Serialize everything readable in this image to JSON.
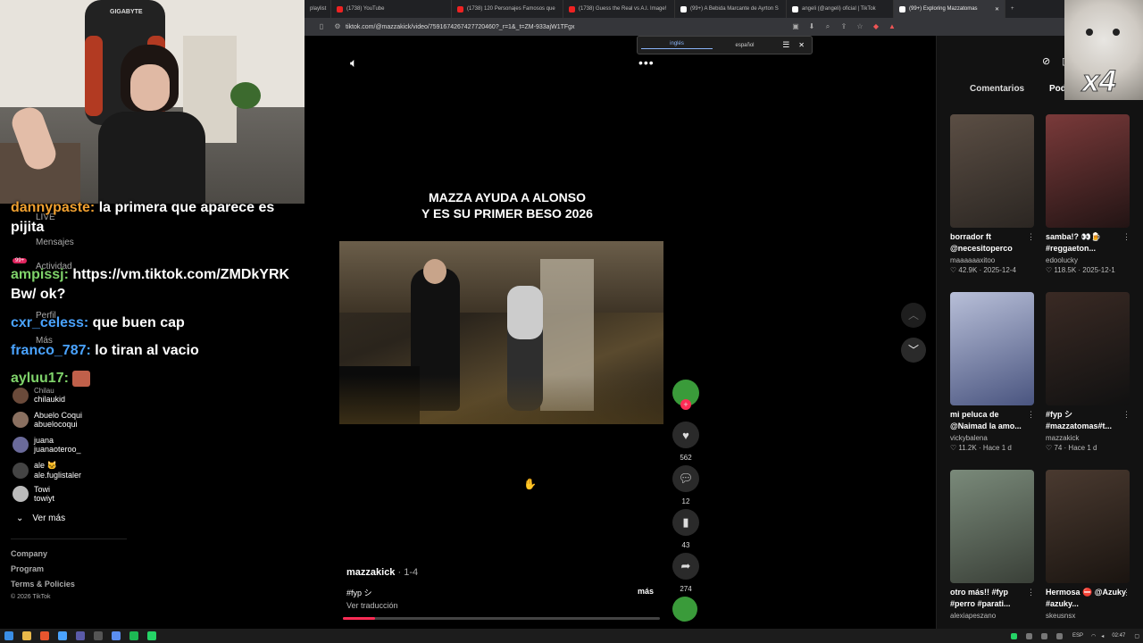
{
  "tabs": [
    {
      "label": "playlist",
      "active": false,
      "color": "#c33"
    },
    {
      "label": "(1738) YouTube",
      "active": false,
      "color": "#e22"
    },
    {
      "label": "(1738) 120 Personajes Famosos que",
      "active": false,
      "color": "#e22"
    },
    {
      "label": "(1738) Guess the Real vs A.I. Image!",
      "active": false,
      "color": "#e22"
    },
    {
      "label": "(99+) A Bebida Marcante de Ayrton S",
      "active": false,
      "color": "#ddd"
    },
    {
      "label": "angeli (@angeli) oficial | TikTok",
      "active": false,
      "color": "#ddd"
    },
    {
      "label": "(99+) Exploring Mazzatomas",
      "active": true,
      "color": "#ddd"
    }
  ],
  "url": "tiktok.com/@mazzakick/video/7591674267427720460?_r=1&_t=ZM-933ajW1TFgx",
  "translate": {
    "from": "inglés",
    "to": "español"
  },
  "chat": [
    {
      "user": "dannypaste:",
      "user_color": "#f0a030",
      "text": "la primera que aparece es"
    },
    {
      "user": "",
      "user_color": "#fff",
      "text": "pijita"
    },
    {
      "user": "ampissj:",
      "user_color": "#7fd36a",
      "text": "https://vm.tiktok.com/ZMDkYRK"
    },
    {
      "user": "",
      "user_color": "#fff",
      "text": "Bw/ ok?"
    },
    {
      "user": "cxr_celess:",
      "user_color": "#4aa3ff",
      "text": "que buen cap"
    },
    {
      "user": "franco_787:",
      "user_color": "#4aa3ff",
      "text": "lo tiran al vacio"
    },
    {
      "user": "ayluu17:",
      "user_color": "#7fd36a",
      "text": ""
    }
  ],
  "nav": {
    "live": "LIVE",
    "mensajes": "Mensajes",
    "actividad": "Actividad",
    "actividad_badge": "99+",
    "perfil": "Perfil",
    "mas": "Más"
  },
  "following": [
    {
      "name": "Chilau",
      "handle": "chilaukid"
    },
    {
      "name": "Abuelo Coqui",
      "handle": "abuelocoqui"
    },
    {
      "name": "juana",
      "handle": "juanaoteroo_"
    },
    {
      "name": "ale 🐱",
      "handle": "ale.fuglistaler"
    },
    {
      "name": "Towi",
      "handle": "towiyt"
    }
  ],
  "ver_mas": "Ver más",
  "footer": {
    "company": "Company",
    "program": "Program",
    "terms": "Terms & Policies",
    "copyright": "© 2026 TikTok"
  },
  "video": {
    "caption_line1": "MAZZA AYUDA A ALONSO",
    "caption_line2": "Y ES SU PRIMER BESO 2026",
    "author": "mazzakick",
    "date": "· 1-4",
    "hashtag": "#fyp シ",
    "more": "más",
    "translate": "Ver traducción",
    "likes": "562",
    "comments": "12",
    "saves": "43",
    "shares": "274",
    "progress": 0.1
  },
  "right_tabs": {
    "comments": "Comentarios",
    "might_like": "Podría interesarte"
  },
  "overlay_badge": "x4",
  "cards": [
    {
      "title": "borrador ft @necesitoperco",
      "user": "maaaaaaxitoo",
      "likes": "42.9K",
      "date": "2025-12-4",
      "colors": [
        "#5b4e44",
        "#2b2622"
      ]
    },
    {
      "title": "samba!? 👀🍺 #reggaeton...",
      "user": "edoolucky",
      "likes": "118.5K",
      "date": "2025-12-1",
      "colors": [
        "#7a3a3a",
        "#221414"
      ]
    },
    {
      "title": "mi peluca de @Naimad la amo...",
      "user": "vickybalena",
      "likes": "11.2K",
      "date": "Hace 1 d",
      "colors": [
        "#b8bfd8",
        "#4a5580"
      ]
    },
    {
      "title": "#fyp シ #mazzatomas#t...",
      "user": "mazzakick",
      "likes": "74",
      "date": "Hace 1 d",
      "colors": [
        "#3a2a24",
        "#111"
      ]
    },
    {
      "title": "otro más!! #fyp #perro #parati...",
      "user": "alexiapeszano",
      "likes": "",
      "date": "",
      "colors": [
        "#7a8a7a",
        "#3a4038"
      ]
    },
    {
      "title": "Hermosa ⛔ @Azuky #azuky...",
      "user": "skeusnsx",
      "likes": "",
      "date": "",
      "colors": [
        "#4a3a30",
        "#1a1410"
      ]
    }
  ],
  "taskbar": {
    "lang": "ESP",
    "time": "02:47"
  }
}
